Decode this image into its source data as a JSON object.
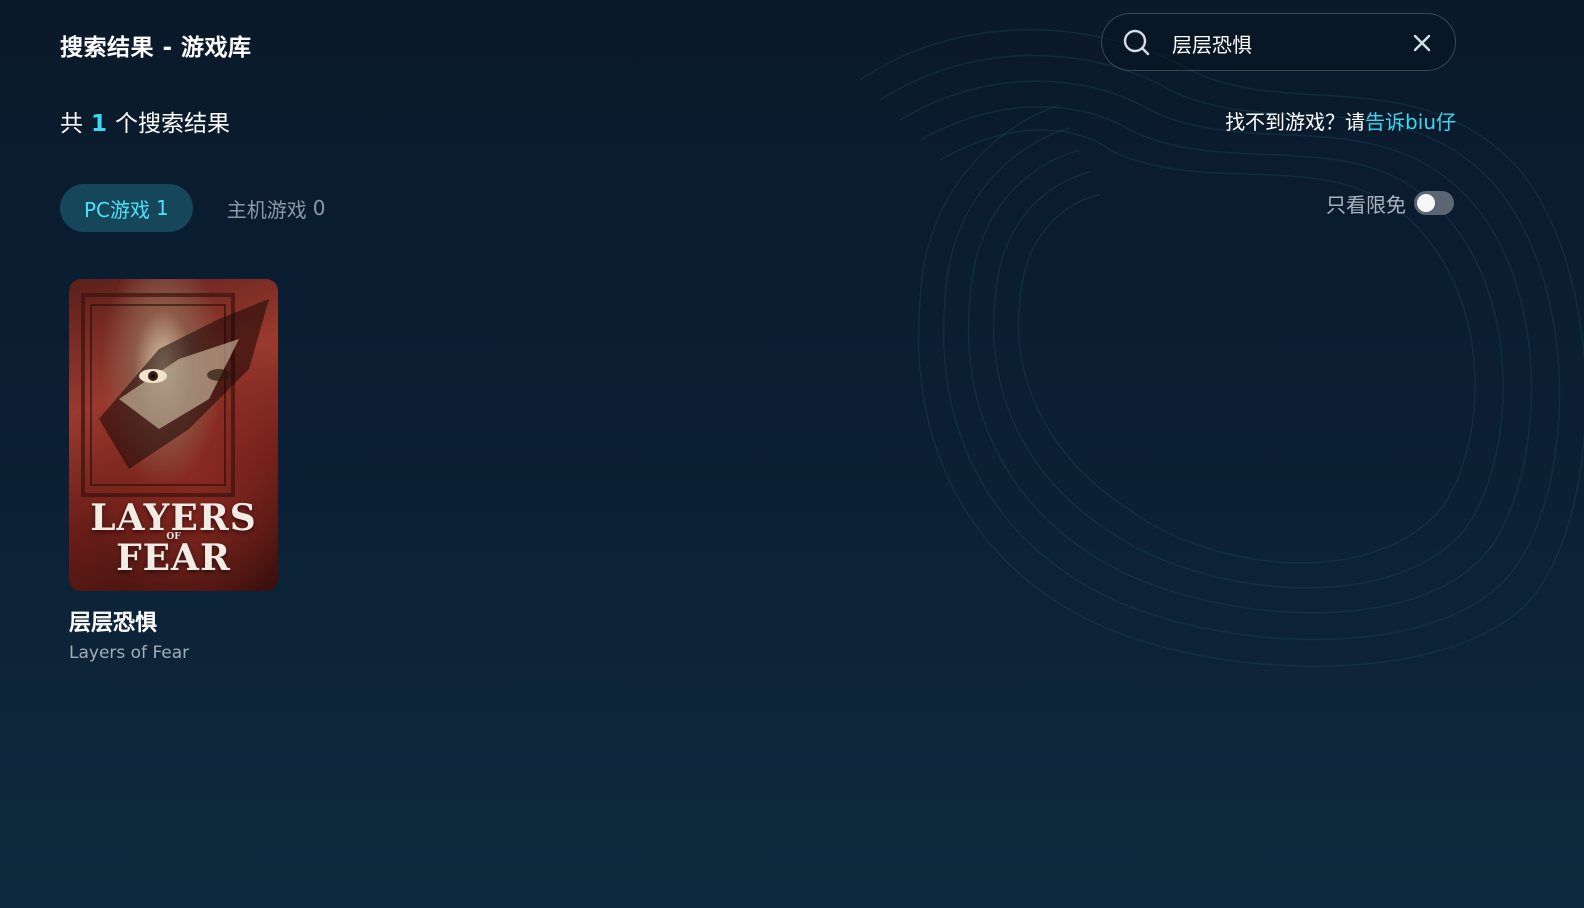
{
  "header": {
    "title": "搜索结果 - 游戏库"
  },
  "search": {
    "value": "层层恐惧",
    "placeholder": ""
  },
  "results": {
    "prefix": "共",
    "count": "1",
    "suffix": "个搜索结果"
  },
  "feedback": {
    "text": "找不到游戏？请",
    "link_label": "告诉biu仔"
  },
  "tabs": [
    {
      "label": "PC游戏",
      "count": "1",
      "active": true
    },
    {
      "label": "主机游戏",
      "count": "0",
      "active": false
    }
  ],
  "filter": {
    "free_only_label": "只看限免",
    "free_only_on": false
  },
  "games": [
    {
      "name": "层层恐惧",
      "subname": "Layers of Fear",
      "cover_lines": [
        "LAYERS",
        "OF",
        "FEAR"
      ]
    }
  ],
  "colors": {
    "accent": "#3fd6f2",
    "active_tab_bg": "#16465a",
    "inactive_text": "#8d98a6"
  }
}
